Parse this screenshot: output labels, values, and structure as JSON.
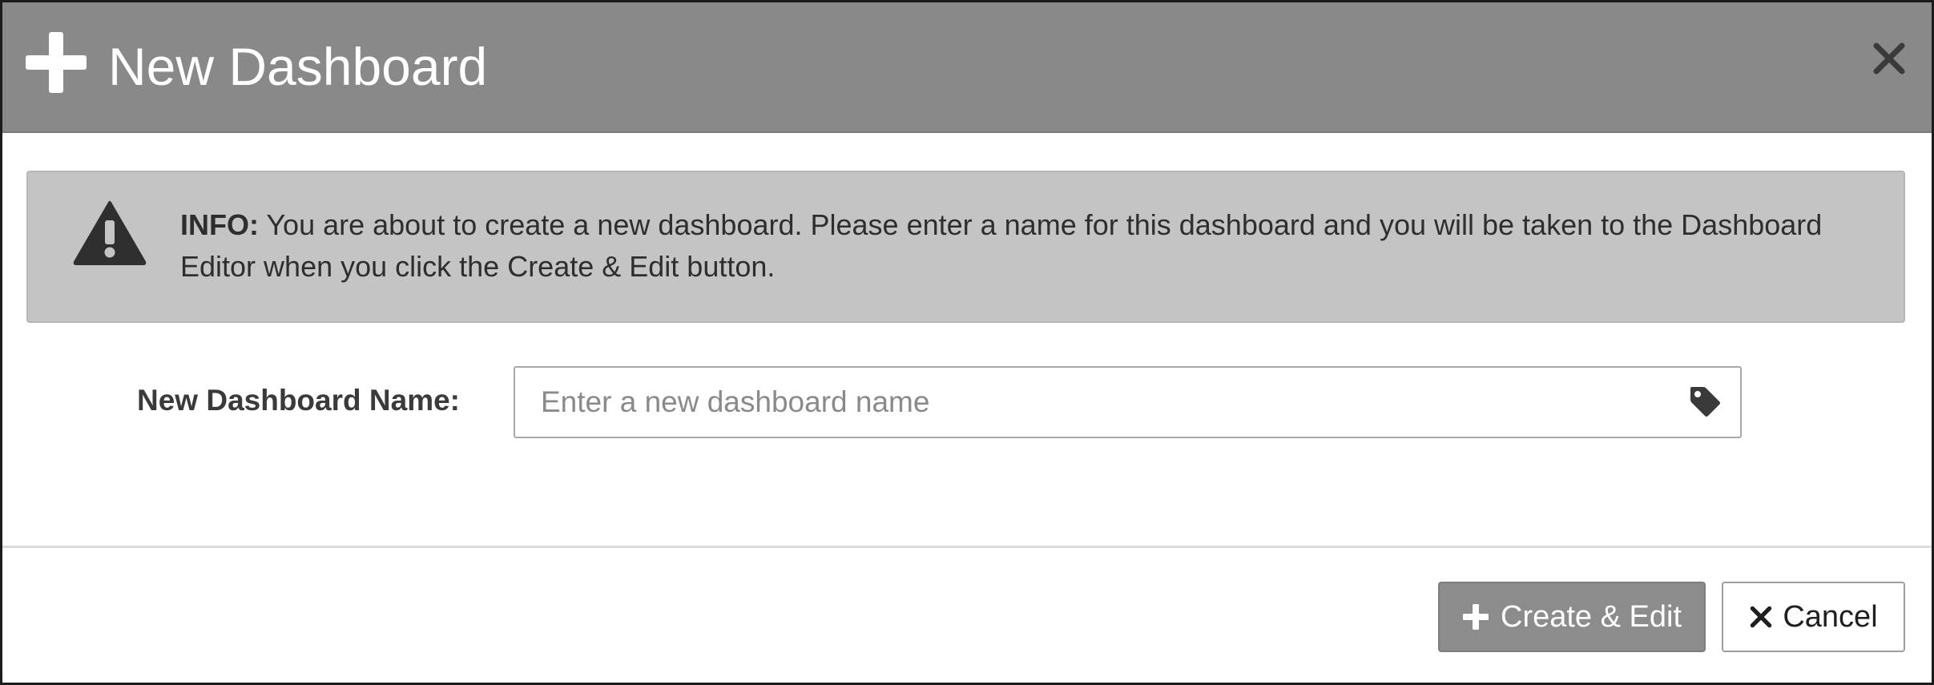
{
  "dialog": {
    "title": "New Dashboard",
    "icons": {
      "header": "plus-icon",
      "close": "close-icon",
      "info": "warning-icon",
      "input": "tag-icon"
    }
  },
  "info": {
    "label": "INFO:",
    "message": " You are about to create a new dashboard. Please enter a name for this dashboard and you will be taken to the Dashboard Editor when you click the Create & Edit button."
  },
  "form": {
    "name_label": "New Dashboard Name:",
    "name_value": "",
    "name_placeholder": "Enter a new dashboard name"
  },
  "footer": {
    "create_label": "Create & Edit",
    "cancel_label": "Cancel"
  },
  "colors": {
    "header_bg": "#898989",
    "info_bg": "#c4c4c4",
    "primary_button_bg": "#8c8c8c"
  }
}
